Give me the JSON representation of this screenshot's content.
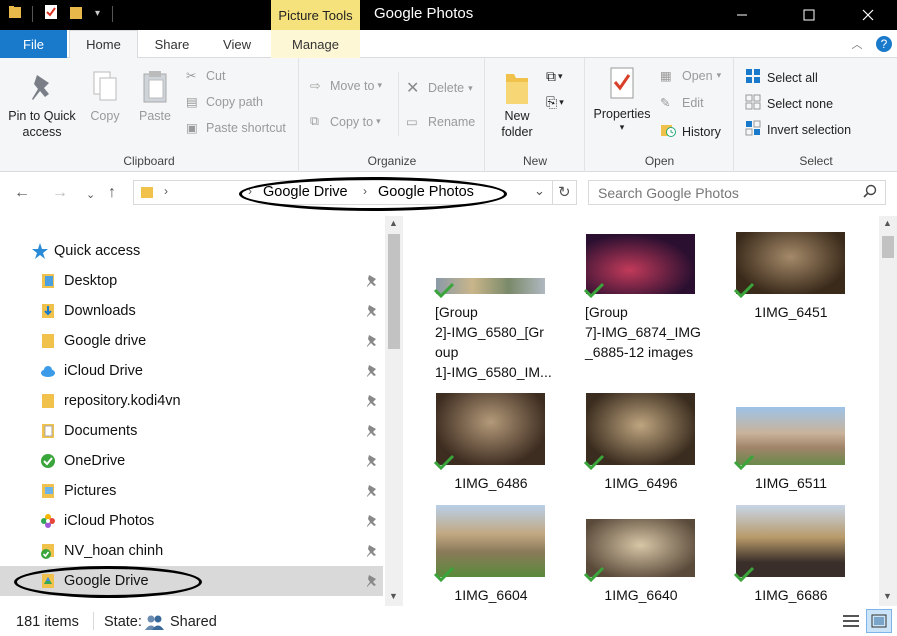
{
  "window": {
    "title": "Google Photos",
    "contextual_tab_group": "Picture Tools"
  },
  "tabs": [
    "File",
    "Home",
    "Share",
    "View",
    "Manage"
  ],
  "ribbon": {
    "clipboard": {
      "label": "Clipboard",
      "pin_quick_access": "Pin to Quick access",
      "copy": "Copy",
      "paste": "Paste",
      "cut": "Cut",
      "copy_path": "Copy path",
      "paste_shortcut": "Paste shortcut"
    },
    "organize": {
      "label": "Organize",
      "move_to": "Move to",
      "copy_to": "Copy to",
      "delete": "Delete",
      "rename": "Rename"
    },
    "new": {
      "label": "New",
      "new_folder": "New folder"
    },
    "open": {
      "label": "Open",
      "properties": "Properties",
      "open": "Open",
      "edit": "Edit",
      "history": "History"
    },
    "select": {
      "label": "Select",
      "select_all": "Select all",
      "select_none": "Select none",
      "invert_selection": "Invert selection"
    }
  },
  "address": {
    "crumbs": [
      "Google Drive",
      "Google Photos"
    ],
    "search_placeholder": "Search Google Photos"
  },
  "nav": {
    "items": [
      {
        "label": "Quick access",
        "icon": "star-icon"
      },
      {
        "label": "Desktop",
        "icon": "folder-icon"
      },
      {
        "label": "Downloads",
        "icon": "download-folder-icon"
      },
      {
        "label": "Google drive",
        "icon": "folder-icon"
      },
      {
        "label": "iCloud Drive",
        "icon": "cloud-icon"
      },
      {
        "label": "repository.kodi4vn",
        "icon": "folder-icon"
      },
      {
        "label": "Documents",
        "icon": "documents-icon"
      },
      {
        "label": "OneDrive",
        "icon": "onedrive-icon"
      },
      {
        "label": "Pictures",
        "icon": "pictures-icon"
      },
      {
        "label": "iCloud Photos",
        "icon": "photos-icon"
      },
      {
        "label": "NV_hoan chinh",
        "icon": "synced-folder-icon"
      },
      {
        "label": "Google Drive",
        "icon": "google-drive-icon"
      }
    ]
  },
  "files": [
    {
      "name": "[Group 2]-IMG_6580_[Group 1]-IMG_6580_IM...",
      "lines": [
        "[Group",
        "2]-IMG_6580_[Gr",
        "oup",
        "1]-IMG_6580_IM..."
      ]
    },
    {
      "name": "[Group 7]-IMG_6874_IMG_6885-12 images",
      "lines": [
        "[Group",
        "7]-IMG_6874_IMG",
        "_6885-12 images"
      ]
    },
    {
      "name": "1IMG_6451"
    },
    {
      "name": "1IMG_6486"
    },
    {
      "name": "1IMG_6496"
    },
    {
      "name": "1IMG_6511"
    },
    {
      "name": "1IMG_6604"
    },
    {
      "name": "1IMG_6640"
    },
    {
      "name": "1IMG_6686"
    }
  ],
  "status": {
    "items_count": "181 items",
    "state_label": "State:",
    "state_value": "Shared"
  },
  "colors": {
    "accent": "#1979ca",
    "contextual": "#f6e27d",
    "sync_check": "#3aa53a"
  }
}
